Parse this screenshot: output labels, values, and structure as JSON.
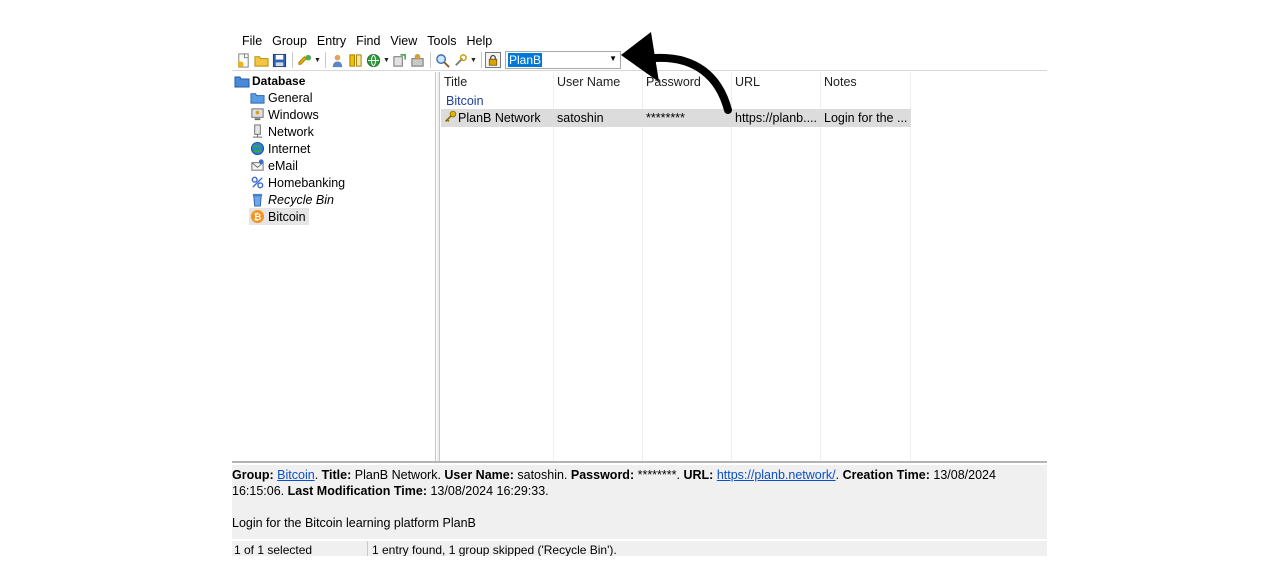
{
  "menu": [
    "File",
    "Group",
    "Entry",
    "Find",
    "View",
    "Tools",
    "Help"
  ],
  "toolbar": {
    "icons": [
      "new-database-icon",
      "open-database-icon",
      "save-database-icon",
      "add-entry-icon",
      "copy-username-icon",
      "copy-password-icon",
      "open-url-icon",
      "perform-autotype-icon",
      "find-icon",
      "entries-view-icon",
      "lock-workspace-icon"
    ],
    "quickfind_value": "PlanB"
  },
  "tree": {
    "root": "Database",
    "groups": [
      {
        "label": "General",
        "icon": "folder-icon"
      },
      {
        "label": "Windows",
        "icon": "windows-icon"
      },
      {
        "label": "Network",
        "icon": "network-icon"
      },
      {
        "label": "Internet",
        "icon": "globe-icon"
      },
      {
        "label": "eMail",
        "icon": "email-icon"
      },
      {
        "label": "Homebanking",
        "icon": "percent-icon"
      },
      {
        "label": "Recycle Bin",
        "icon": "recycle-bin-icon"
      },
      {
        "label": "Bitcoin",
        "icon": "bitcoin-icon"
      }
    ]
  },
  "list": {
    "columns": [
      "Title",
      "User Name",
      "Password",
      "URL",
      "Notes"
    ],
    "group_header": "Bitcoin",
    "rows": [
      {
        "title": "PlanB Network",
        "username": "satoshin",
        "password": "********",
        "url": "https://planb....",
        "notes": "Login for the ..."
      }
    ]
  },
  "details": {
    "group_label": "Group:",
    "group_value": "Bitcoin",
    "title_label": "Title:",
    "title_value": "PlanB Network.",
    "username_label": "User Name:",
    "username_value": "satoshin.",
    "password_label": "Password:",
    "password_value": "********.",
    "url_label": "URL:",
    "url_value": "https://planb.network/",
    "creation_label": "Creation Time:",
    "creation_value": "13/08/2024 16:15:06.",
    "modification_label": "Last Modification Time:",
    "modification_value": "13/08/2024 16:29:33.",
    "notes": "Login for the Bitcoin learning platform PlanB"
  },
  "status": {
    "selection": "1 of 1 selected",
    "message": "1 entry found, 1 group skipped ('Recycle Bin')."
  },
  "colors": {
    "selection_bg": "#dcdcdc",
    "quickfind_highlight": "#0078d7",
    "group_header_text": "#1f3f9a",
    "link": "#0b4fc7",
    "panel_bg": "#f0f0f0"
  }
}
